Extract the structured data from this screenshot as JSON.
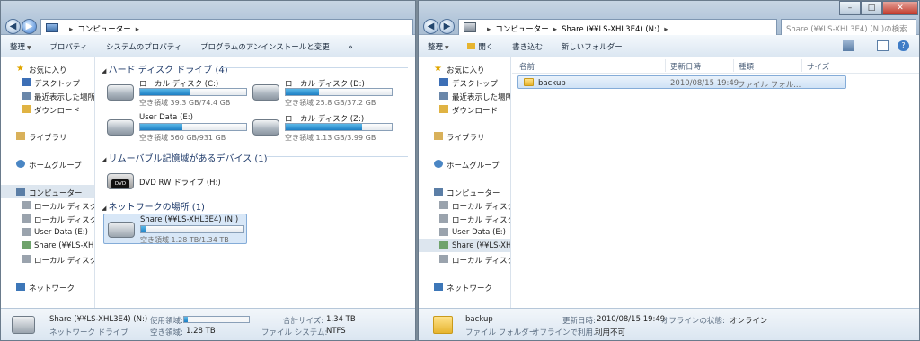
{
  "left": {
    "breadcrumb": [
      "コンピューター"
    ],
    "toolbar": [
      "整理",
      "プロパティ",
      "システムのプロパティ",
      "プログラムのアンインストールと変更",
      "»"
    ],
    "nav": {
      "favorites": "お気に入り",
      "desktop": "デスクトップ",
      "recent": "最近表示した場所",
      "downloads": "ダウンロード",
      "libraries": "ライブラリ",
      "homegroup": "ホームグループ",
      "computer": "コンピューター",
      "drives": [
        "ローカル ディスク (",
        "ローカル ディスク (",
        "User Data (E:)",
        "Share (¥¥LS-XHL3",
        "ローカル ディスク ("
      ],
      "network": "ネットワーク"
    },
    "groups": {
      "hdd": "ハード ディスク ドライブ (4)",
      "removable": "リムーバブル記憶域があるデバイス (1)",
      "network": "ネットワークの場所 (1)"
    },
    "drives": [
      {
        "name": "ローカル ディスク (C:)",
        "space": "空き領域 39.3 GB/74.4 GB",
        "used": 0.47
      },
      {
        "name": "ローカル ディスク (D:)",
        "space": "空き領域 25.8 GB/37.2 GB",
        "used": 0.31
      },
      {
        "name": "User Data (E:)",
        "space": "空き領域 560 GB/931 GB",
        "used": 0.4
      },
      {
        "name": "ローカル ディスク (Z:)",
        "space": "空き領域 1.13 GB/3.99 GB",
        "used": 0.72
      }
    ],
    "dvd": {
      "name": "DVD RW ドライブ (H:)",
      "badge": "DVD"
    },
    "share": {
      "name": "Share (¥¥LS-XHL3E4) (N:)",
      "space": "空き領域 1.28 TB/1.34 TB",
      "used": 0.05
    },
    "status": {
      "title": "Share (¥¥LS-XHL3E4) (N:)",
      "subtitle": "ネットワーク ドライブ",
      "used_label": "使用領域:",
      "free_label": "空き領域:",
      "free_value": "1.28 TB",
      "total_label": "合計サイズ:",
      "total_value": "1.34 TB",
      "fs_label": "ファイル システム:",
      "fs_value": "NTFS",
      "used": 0.05
    }
  },
  "right": {
    "breadcrumb": [
      "コンピューター",
      "Share (¥¥LS-XHL3E4) (N:)"
    ],
    "search_placeholder": "Share (¥¥LS-XHL3E4) (N:)の検索",
    "toolbar": [
      "整理",
      "開く",
      "書き込む",
      "新しいフォルダー"
    ],
    "columns": [
      "名前",
      "更新日時",
      "種類",
      "サイズ"
    ],
    "file": {
      "name": "backup",
      "date": "2010/08/15 19:49",
      "type": "ファイル フォル..."
    },
    "nav": {
      "favorites": "お気に入り",
      "desktop": "デスクトップ",
      "recent": "最近表示した場所",
      "downloads": "ダウンロード",
      "libraries": "ライブラリ",
      "homegroup": "ホームグループ",
      "computer": "コンピューター",
      "drives": [
        "ローカル ディスク (",
        "ローカル ディスク (",
        "User Data (E:)",
        "Share (¥¥LS-XHL3",
        "ローカル ディスク ("
      ],
      "network": "ネットワーク"
    },
    "status": {
      "name": "backup",
      "subtitle": "ファイル フォルダー",
      "modified_label": "更新日時:",
      "modified_value": "2010/08/15 19:49",
      "offline_status_label": "オフラインの状態:",
      "offline_status_value": "オンライン",
      "offline_label": "オフラインで利用...",
      "offline_value": "利用不可"
    },
    "window_controls": [
      "–",
      "□",
      "✕"
    ]
  }
}
